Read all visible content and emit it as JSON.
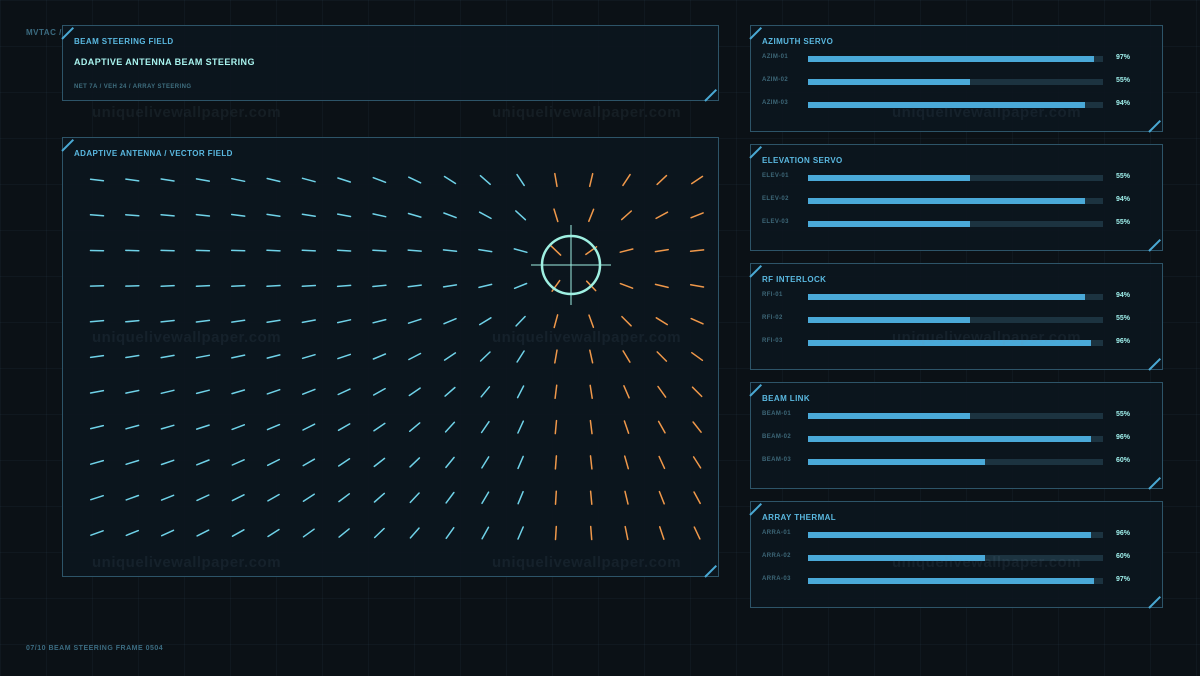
{
  "breadcrumb": "MVTAC /",
  "footer": "07/10  BEAM STEERING  FRAME 0504",
  "header_panel": {
    "label": "BEAM STEERING FIELD",
    "title": "ADAPTIVE ANTENNA BEAM STEERING",
    "subtitle": "NET 7A / VEH 24 / ARRAY STEERING"
  },
  "field_panel": {
    "label": "ADAPTIVE ANTENNA / VECTOR FIELD"
  },
  "watermark": "uniquelivewallpaper.com",
  "colors": {
    "cool": "#6fd2e8",
    "warm": "#f0984a",
    "bar": "#4aa9d8",
    "reticle": "#9ff0e2"
  },
  "status_panels": [
    {
      "title": "AZIMUTH SERVO",
      "rows": [
        {
          "label": "AZIM-01",
          "value": 97,
          "text": "97%"
        },
        {
          "label": "AZIM-02",
          "value": 55,
          "text": "55%"
        },
        {
          "label": "AZIM-03",
          "value": 94,
          "text": "94%"
        }
      ]
    },
    {
      "title": "ELEVATION SERVO",
      "rows": [
        {
          "label": "ELEV-01",
          "value": 55,
          "text": "55%"
        },
        {
          "label": "ELEV-02",
          "value": 94,
          "text": "94%"
        },
        {
          "label": "ELEV-03",
          "value": 55,
          "text": "55%"
        }
      ]
    },
    {
      "title": "RF INTERLOCK",
      "rows": [
        {
          "label": "RFI-01",
          "value": 94,
          "text": "94%"
        },
        {
          "label": "RFI-02",
          "value": 55,
          "text": "55%"
        },
        {
          "label": "RFI-03",
          "value": 96,
          "text": "96%"
        }
      ]
    },
    {
      "title": "BEAM LINK",
      "rows": [
        {
          "label": "BEAM-01",
          "value": 55,
          "text": "55%"
        },
        {
          "label": "BEAM-02",
          "value": 96,
          "text": "96%"
        },
        {
          "label": "BEAM-03",
          "value": 60,
          "text": "60%"
        }
      ]
    },
    {
      "title": "ARRAY THERMAL",
      "rows": [
        {
          "label": "ARRA-01",
          "value": 96,
          "text": "96%"
        },
        {
          "label": "ARRA-02",
          "value": 60,
          "text": "60%"
        },
        {
          "label": "ARRA-03",
          "value": 97,
          "text": "97%"
        }
      ]
    }
  ]
}
